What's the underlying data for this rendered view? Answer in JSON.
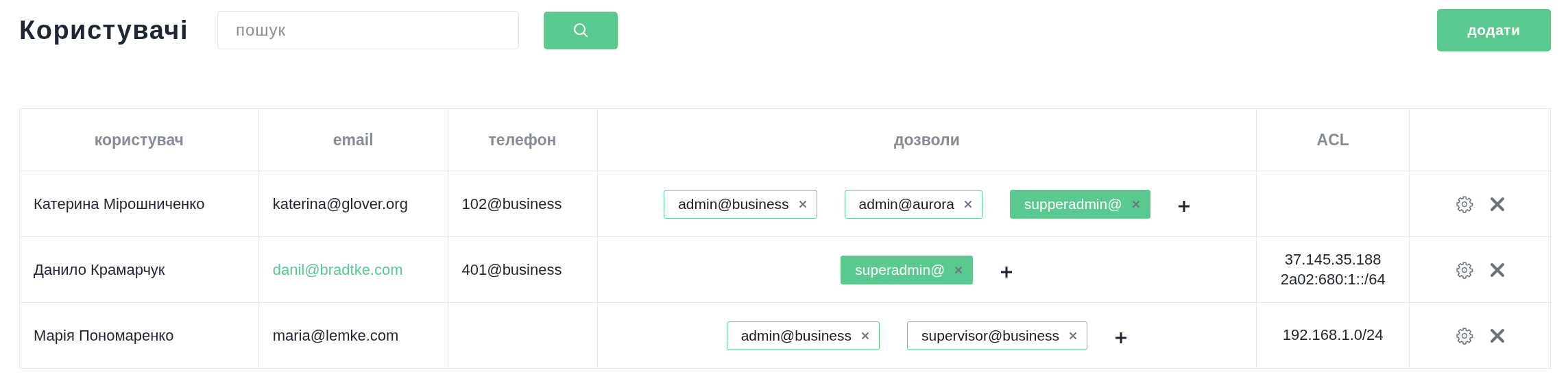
{
  "title": "Користувачі",
  "search": {
    "placeholder": "пошук"
  },
  "add_button": "додати",
  "table": {
    "columns": [
      "користувач",
      "email",
      "телефон",
      "дозволи",
      "ACL"
    ],
    "rows": [
      {
        "user": "Катерина Мірошниченко",
        "email": "katerina@glover.org",
        "email_highlighted": false,
        "phone": "102@business",
        "permissions": [
          {
            "label": "admin@business",
            "selected": false
          },
          {
            "label": "admin@aurora",
            "selected": false
          },
          {
            "label": "supperadmin@",
            "selected": true
          }
        ],
        "acl": []
      },
      {
        "user": "Данило Крамарчук",
        "email": "danil@bradtke.com",
        "email_highlighted": true,
        "phone": "401@business",
        "permissions": [
          {
            "label": "superadmin@",
            "selected": true
          }
        ],
        "acl": [
          "37.145.35.188",
          "2a02:680:1::/64"
        ]
      },
      {
        "user": "Марія Пономаренко",
        "email": "maria@lemke.com",
        "email_highlighted": false,
        "phone": "",
        "permissions": [
          {
            "label": "admin@business",
            "selected": false
          },
          {
            "label": "supervisor@business",
            "selected": false
          }
        ],
        "acl": [
          "192.168.1.0/24"
        ]
      }
    ]
  }
}
